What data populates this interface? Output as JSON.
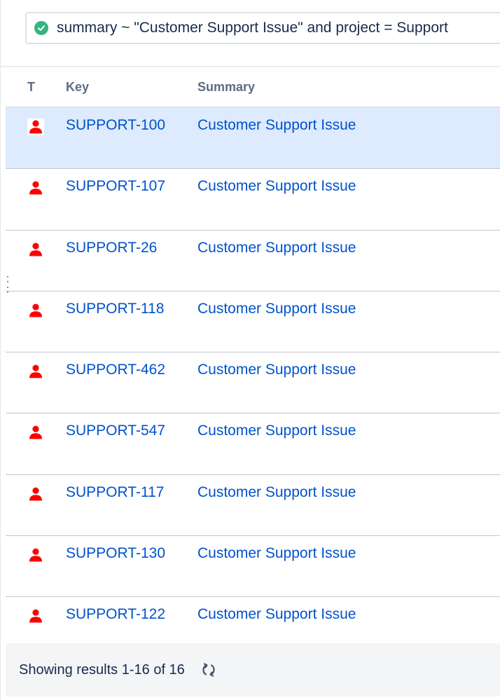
{
  "query": {
    "status_icon": "check-circle-icon",
    "text": "summary ~ \"Customer Support Issue\" and project = Support"
  },
  "table": {
    "columns": {
      "type": "T",
      "key": "Key",
      "summary": "Summary"
    },
    "type_icon": "customer-request-person-icon",
    "rows": [
      {
        "key": "SUPPORT-100",
        "summary": "Customer Support Issue"
      },
      {
        "key": "SUPPORT-107",
        "summary": "Customer Support Issue"
      },
      {
        "key": "SUPPORT-26",
        "summary": "Customer Support Issue"
      },
      {
        "key": "SUPPORT-118",
        "summary": "Customer Support Issue"
      },
      {
        "key": "SUPPORT-462",
        "summary": "Customer Support Issue"
      },
      {
        "key": "SUPPORT-547",
        "summary": "Customer Support Issue"
      },
      {
        "key": "SUPPORT-117",
        "summary": "Customer Support Issue"
      },
      {
        "key": "SUPPORT-130",
        "summary": "Customer Support Issue"
      },
      {
        "key": "SUPPORT-122",
        "summary": "Customer Support Issue"
      }
    ]
  },
  "footer": {
    "results_text": "Showing results 1-16 of 16",
    "refresh_icon": "refresh-icon"
  },
  "colors": {
    "link": "#0052cc",
    "selected_row": "#deebff",
    "valid_query": "#36b37e",
    "type_icon": "#ff0000"
  }
}
